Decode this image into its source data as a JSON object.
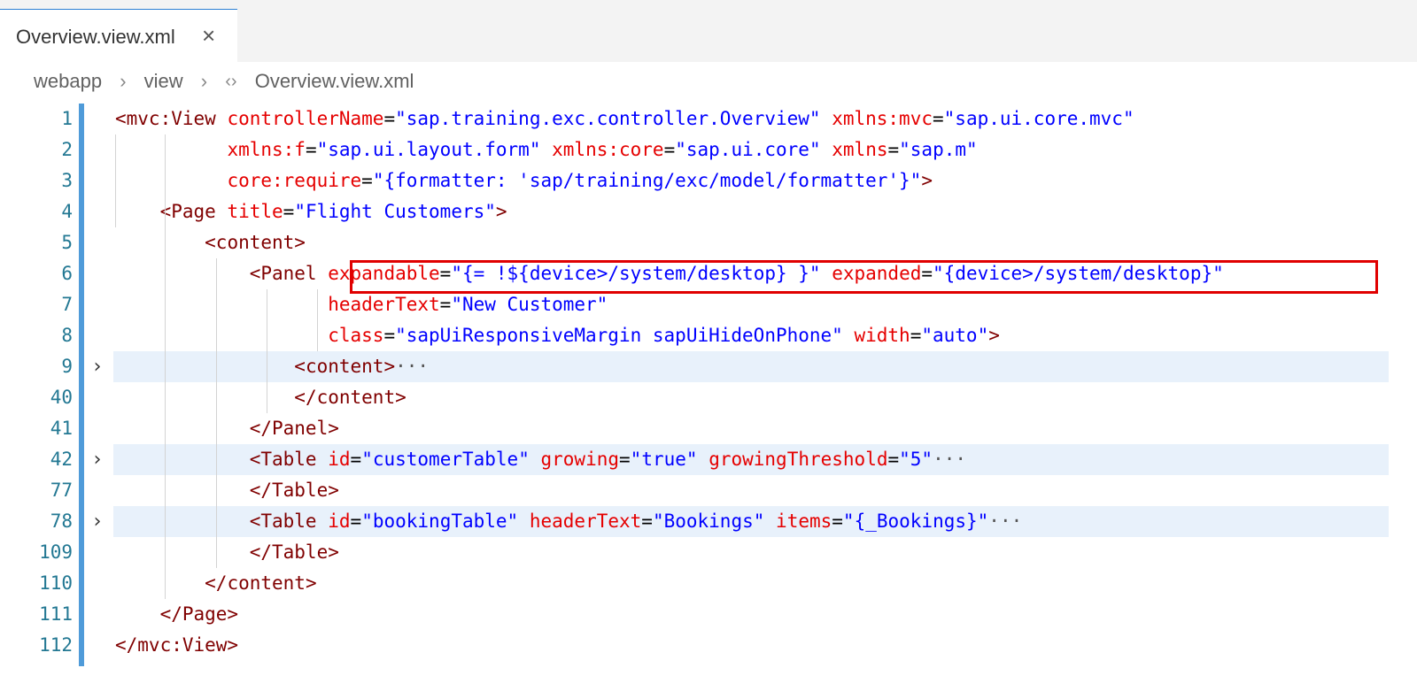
{
  "tab": {
    "label": "Overview.view.xml",
    "close_glyph": "×"
  },
  "breadcrumb": {
    "items": [
      "webapp",
      "view",
      "Overview.view.xml"
    ],
    "separator": "›",
    "file_icon": "‹›"
  },
  "editor": {
    "fold_icon": "›",
    "lines": [
      {
        "num": "1",
        "tokens": [
          [
            "t",
            "<mvc:View "
          ],
          [
            "a",
            "controllerName"
          ],
          [
            "p",
            "="
          ],
          [
            "v",
            "\"sap.training.exc.controller.Overview\""
          ],
          [
            "p",
            " "
          ],
          [
            "a",
            "xmlns:mvc"
          ],
          [
            "p",
            "="
          ],
          [
            "v",
            "\"sap.ui.core.mvc\""
          ]
        ]
      },
      {
        "num": "2",
        "tokens": [
          [
            "p",
            "          "
          ],
          [
            "a",
            "xmlns:f"
          ],
          [
            "p",
            "="
          ],
          [
            "v",
            "\"sap.ui.layout.form\""
          ],
          [
            "p",
            " "
          ],
          [
            "a",
            "xmlns:core"
          ],
          [
            "p",
            "="
          ],
          [
            "v",
            "\"sap.ui.core\""
          ],
          [
            "p",
            " "
          ],
          [
            "a",
            "xmlns"
          ],
          [
            "p",
            "="
          ],
          [
            "v",
            "\"sap.m\""
          ]
        ]
      },
      {
        "num": "3",
        "tokens": [
          [
            "p",
            "          "
          ],
          [
            "a",
            "core:require"
          ],
          [
            "p",
            "="
          ],
          [
            "v",
            "\"{formatter: 'sap/training/exc/model/formatter'}\""
          ],
          [
            "t",
            ">"
          ]
        ]
      },
      {
        "num": "4",
        "tokens": [
          [
            "p",
            "    "
          ],
          [
            "t",
            "<Page "
          ],
          [
            "a",
            "title"
          ],
          [
            "p",
            "="
          ],
          [
            "v",
            "\"Flight Customers\""
          ],
          [
            "t",
            ">"
          ]
        ]
      },
      {
        "num": "5",
        "tokens": [
          [
            "p",
            "        "
          ],
          [
            "t",
            "<content>"
          ]
        ]
      },
      {
        "num": "6",
        "tokens": [
          [
            "p",
            "            "
          ],
          [
            "t",
            "<Panel "
          ],
          [
            "a",
            "expandable"
          ],
          [
            "p",
            "="
          ],
          [
            "v",
            "\"{= !${device>/system/desktop} }\""
          ],
          [
            "p",
            " "
          ],
          [
            "a",
            "expanded"
          ],
          [
            "p",
            "="
          ],
          [
            "v",
            "\"{device>/system/desktop}\""
          ]
        ]
      },
      {
        "num": "7",
        "tokens": [
          [
            "p",
            "                   "
          ],
          [
            "a",
            "headerText"
          ],
          [
            "p",
            "="
          ],
          [
            "v",
            "\"New Customer\""
          ]
        ]
      },
      {
        "num": "8",
        "tokens": [
          [
            "p",
            "                   "
          ],
          [
            "a",
            "class"
          ],
          [
            "p",
            "="
          ],
          [
            "v",
            "\"sapUiResponsiveMargin sapUiHideOnPhone\""
          ],
          [
            "p",
            " "
          ],
          [
            "a",
            "width"
          ],
          [
            "p",
            "="
          ],
          [
            "v",
            "\"auto\""
          ],
          [
            "t",
            ">"
          ]
        ]
      },
      {
        "num": "9",
        "folded": true,
        "tokens": [
          [
            "p",
            "                "
          ],
          [
            "t",
            "<content>"
          ],
          [
            "ell",
            "···"
          ]
        ]
      },
      {
        "num": "40",
        "tokens": [
          [
            "p",
            "                "
          ],
          [
            "t",
            "</content>"
          ]
        ]
      },
      {
        "num": "41",
        "tokens": [
          [
            "p",
            "            "
          ],
          [
            "t",
            "</Panel>"
          ]
        ]
      },
      {
        "num": "42",
        "folded": true,
        "tokens": [
          [
            "p",
            "            "
          ],
          [
            "t",
            "<Table "
          ],
          [
            "a",
            "id"
          ],
          [
            "p",
            "="
          ],
          [
            "v",
            "\"customerTable\""
          ],
          [
            "p",
            " "
          ],
          [
            "a",
            "growing"
          ],
          [
            "p",
            "="
          ],
          [
            "v",
            "\"true\""
          ],
          [
            "p",
            " "
          ],
          [
            "a",
            "growingThreshold"
          ],
          [
            "p",
            "="
          ],
          [
            "v",
            "\"5\""
          ],
          [
            "ell",
            "···"
          ]
        ]
      },
      {
        "num": "77",
        "tokens": [
          [
            "p",
            "            "
          ],
          [
            "t",
            "</Table>"
          ]
        ]
      },
      {
        "num": "78",
        "folded": true,
        "tokens": [
          [
            "p",
            "            "
          ],
          [
            "t",
            "<Table "
          ],
          [
            "a",
            "id"
          ],
          [
            "p",
            "="
          ],
          [
            "v",
            "\"bookingTable\""
          ],
          [
            "p",
            " "
          ],
          [
            "a",
            "headerText"
          ],
          [
            "p",
            "="
          ],
          [
            "v",
            "\"Bookings\""
          ],
          [
            "p",
            " "
          ],
          [
            "a",
            "items"
          ],
          [
            "p",
            "="
          ],
          [
            "v",
            "\"{_Bookings}\""
          ],
          [
            "ell",
            "···"
          ]
        ]
      },
      {
        "num": "109",
        "tokens": [
          [
            "p",
            "            "
          ],
          [
            "t",
            "</Table>"
          ]
        ]
      },
      {
        "num": "110",
        "tokens": [
          [
            "p",
            "        "
          ],
          [
            "t",
            "</content>"
          ]
        ]
      },
      {
        "num": "111",
        "tokens": [
          [
            "p",
            "    "
          ],
          [
            "t",
            "</Page>"
          ]
        ]
      },
      {
        "num": "112",
        "tokens": [
          [
            "t",
            "</mvc:View>"
          ]
        ]
      }
    ]
  },
  "colors": {
    "tag": "#800000",
    "attr": "#e50000",
    "value": "#0000ff",
    "line_number": "#237893",
    "folded_bg": "#e8f1fb",
    "highlight": "#e00000"
  }
}
